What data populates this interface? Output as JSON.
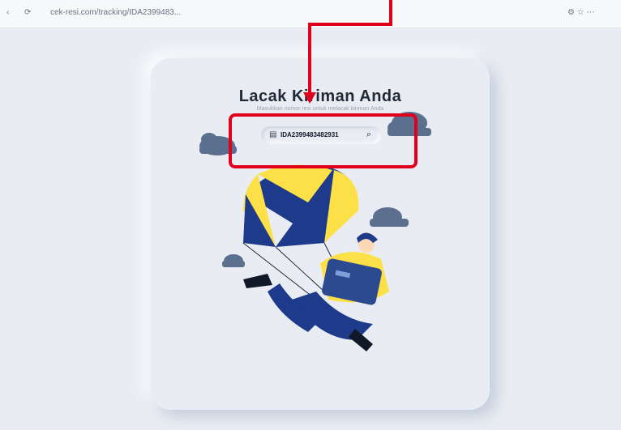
{
  "browser": {
    "nav_back": "‹",
    "nav_reload": "⟳",
    "address": "cek-resi.com/tracking/IDA2399483...",
    "right_icons": "⚙  ☆  ⋯"
  },
  "card": {
    "title": "Lacak Kiriman Anda",
    "subtitle": "Masukkan nomor resi untuk melacak kiriman Anda"
  },
  "search": {
    "value": "IDA2399483482931",
    "doc_icon": "document-icon",
    "search_icon": "search-icon"
  },
  "colors": {
    "accent_red": "#e0001b",
    "navy": "#1e3a8a",
    "yellow": "#fde047",
    "cloud": "#64748b"
  }
}
